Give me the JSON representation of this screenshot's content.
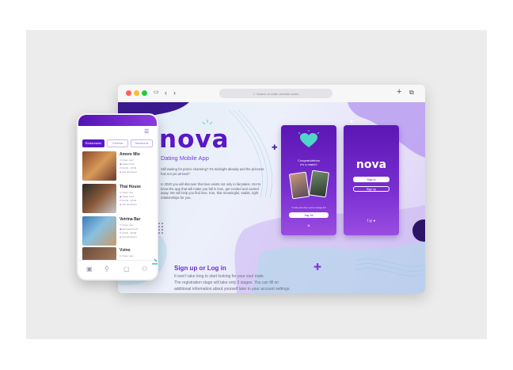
{
  "browser": {
    "url_placeholder": "Search or enter website name",
    "plus_label": "+",
    "window_colors": [
      "#ff5f57",
      "#febc2e",
      "#28c840"
    ]
  },
  "landing": {
    "brand": "nova",
    "subtitle": "Dating Mobile App",
    "intro": "Still waiting for prince charming? It's midnight already and the princess has not yet arrived?",
    "body": "In 2020 you will discover that love exists not only in fairytales. Get to know the app that will make you fall in love, get excited and carried away. We will help you find love, true, that meaningful, stable, right relationships for you.",
    "signup_title": "Sign up or Log in",
    "signup_line1": "It won't take long to start looking for your soul mate.",
    "signup_line2": "The registration stage will take only 3 stages. You can fill on",
    "signup_line3": "additional information about yourself later in your account settings."
  },
  "match_card": {
    "title_line1": "Congratulations",
    "title_line2": "it's a match!",
    "message": "You like each other, send a message first",
    "button": "Say hi!",
    "close": "×"
  },
  "login_card": {
    "brand": "nova",
    "sign_in": "Sign in",
    "sign_up": "Sign up",
    "social": "f ◎ ●"
  },
  "phone": {
    "tabs": [
      "Restaurants",
      "Cinema",
      "Museums"
    ],
    "active_tab": "Restaurants",
    "items": [
      {
        "name": "Amore Mio",
        "lines": [
          "Open now",
          "Italian food",
          "02:00 - 23:00",
          "Get directions"
        ]
      },
      {
        "name": "Thai House",
        "lines": [
          "Open now",
          "Asian food",
          "01:00 - 22:00",
          "Get directions"
        ]
      },
      {
        "name": "Vetrina Bar",
        "lines": [
          "Open now",
          "European food",
          "12:00 - 00:00",
          "Get directions"
        ]
      },
      {
        "name": "Vvino",
        "lines": [
          "Open now",
          "Wine bar"
        ]
      }
    ]
  }
}
